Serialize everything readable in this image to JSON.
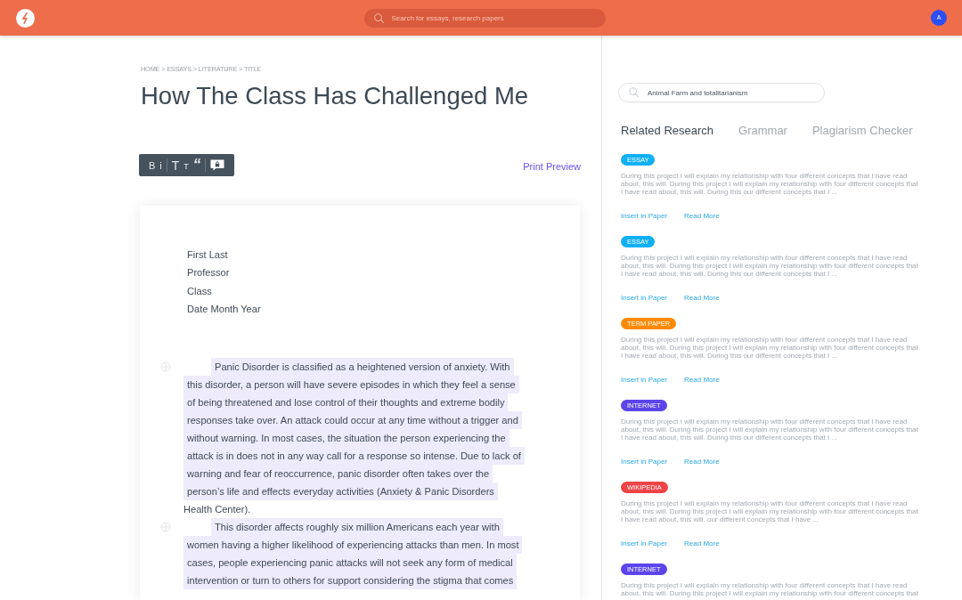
{
  "header": {
    "search": {
      "placeholder": "Search for essays, research papers"
    },
    "avatar": {
      "initial": "A"
    }
  },
  "breadcrumb": "HOME > ESSAYS > LITERATURE > TITLE",
  "title": "How The Class Has Challenged Me",
  "toolbar": {
    "groups": [
      [
        {
          "kind": "bold",
          "label": "B"
        },
        {
          "kind": "italic",
          "label": "i"
        }
      ],
      [
        {
          "kind": "heading_large",
          "label": "T"
        },
        {
          "kind": "heading_small",
          "label": "T"
        },
        {
          "kind": "quote",
          "label": "“"
        }
      ],
      [
        {
          "kind": "comment"
        }
      ]
    ]
  },
  "print_preview": "Print Preview",
  "document": {
    "heading_lines": [
      "First Last",
      "Professor",
      "Class",
      "Date Month Year"
    ],
    "paragraphs": [
      {
        "segments": [
          {
            "text": "Panic Disorder is classified as a heightened version of anxiety. With this disorder, a person will have severe episodes in which they feel a sense of being threatened and lose control of their thoughts and extreme bodily responses take over. An attack could occur at any time without a trigger and without warning. In most cases, the situation the person experiencing the attack is in does not in any way call for a response so intense. Due to lack of warning and fear of reoccurrence, panic disorder often takes over the person’s life and effects everyday activities (Anxiety & Panic Disorders",
            "highlighted": true
          },
          {
            "text": " Health Center).",
            "highlighted": false
          }
        ]
      },
      {
        "segments": [
          {
            "text": "This disorder affects roughly six million Americans each year with women having a higher likelihood of experiencing attacks than men. In most cases, people experiencing panic attacks will not seek any form of medical intervention or turn to others for support considering the stigma that comes",
            "highlighted": true
          }
        ]
      }
    ]
  },
  "sidebar": {
    "search": {
      "value": "Animal Farm and totalitarianism"
    },
    "tabs": [
      {
        "label": "Related Research",
        "selected": true
      },
      {
        "label": "Grammar",
        "selected": false
      },
      {
        "label": "Plagiarism Checker",
        "selected": false
      }
    ],
    "results": [
      {
        "tag": "ESSAY",
        "color": "#0fb0f5",
        "excerpt": "During this project I will explain my relationship with four different concepts that I have read about, this will. During this project I will explain my relationship with four different concepts that I have read about, this will. During this our different concepts that I ...",
        "links": [
          "Insert in Paper",
          "Read More"
        ]
      },
      {
        "tag": "ESSAY",
        "color": "#0fb0f5",
        "excerpt": "During this project I will explain my relationship with four different concepts that I have read about, this will. During this project I will explain my relationship with four different concepts that I have read about, this will. During this our different concepts that I ...",
        "links": [
          "Insert in Paper",
          "Read More"
        ]
      },
      {
        "tag": "TERM PAPER",
        "color": "#ff8a00",
        "excerpt": "During this project I will explain my relationship with four different concepts that I have read about, this will. During this project I will explain my relationship with four different concepts that I have read about, this will. During this our different concepts that I ...",
        "links": [
          "Insert in Paper",
          "Read More"
        ]
      },
      {
        "tag": "INTERNET",
        "color": "#5b45ea",
        "excerpt": "During this project I will explain my relationship with four different concepts that I have read about, this will. During this project I will explain my relationship with four different concepts that I have read about, this will. During this our different concepts that I ...",
        "links": [
          "Insert in Paper",
          "Read More"
        ]
      },
      {
        "tag": "WIKIPEDIA",
        "color": "#ee4448",
        "excerpt": "During this project I will explain my relationship with four different concepts that I have read about, this will. During this project I will explain my relationship with four different concepts that I have read about, this will. our different concepts that I have ...",
        "links": [
          "Insert in Paper",
          "Read More"
        ]
      },
      {
        "tag": "INTERNET",
        "color": "#5b45ea",
        "excerpt": "During this project I will explain my relationship with four different concepts that I have read about, this will. During this project I will explain my relationship with four different concepts that"
      }
    ]
  }
}
